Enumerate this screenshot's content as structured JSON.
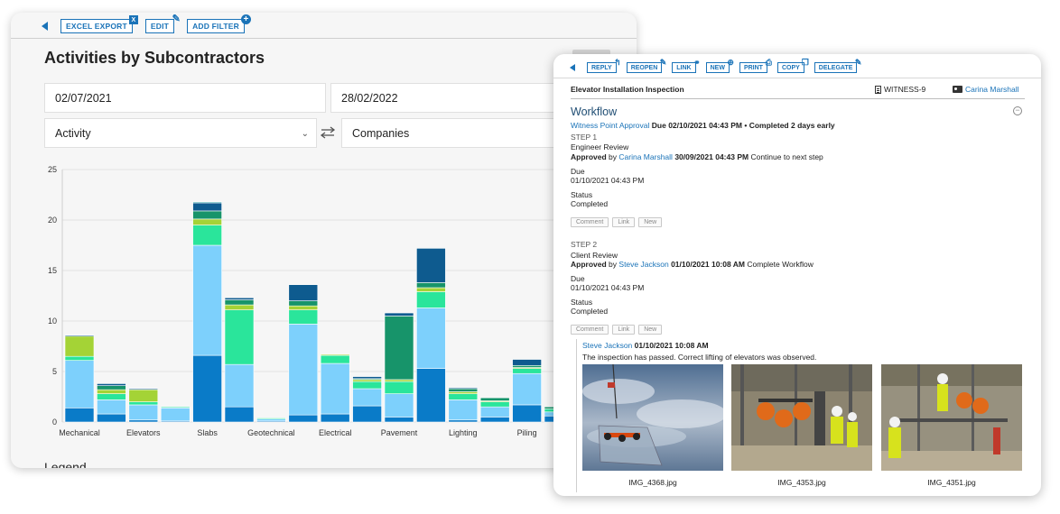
{
  "left": {
    "toolbar": {
      "excel_label": "EXCEL EXPORT",
      "excel_badge": "X",
      "edit_label": "EDIT",
      "filter_label": "ADD FILTER",
      "filter_badge": "+"
    },
    "title": "Activities by Subcontractors",
    "filters": {
      "start_date": "02/07/2021",
      "end_date": "28/02/2022",
      "activity_select": "Activity",
      "companies_select": "Companies"
    },
    "legend_heading": "Legend"
  },
  "chart_data": {
    "type": "bar",
    "stacked": true,
    "ylim": [
      0,
      25
    ],
    "yticks": [
      0,
      5,
      10,
      15,
      20,
      25
    ],
    "grid": true,
    "categories": [
      "Mechanical",
      "",
      "Elevators",
      "",
      "Slabs",
      "",
      "Geotechnical",
      "",
      "Electrical",
      "",
      "Pavement",
      "",
      "Lighting",
      "",
      "Piling",
      ""
    ],
    "series": [
      {
        "color": "#0a7bc8",
        "values": [
          1.4,
          0.8,
          0.2,
          0.1,
          6.6,
          1.5,
          0.1,
          0.7,
          0.8,
          1.6,
          0.5,
          5.3,
          0.2,
          0.5,
          1.7,
          0.6
        ]
      },
      {
        "color": "#7dd0fc",
        "values": [
          4.7,
          1.4,
          1.5,
          1.3,
          10.9,
          4.2,
          0.2,
          9.0,
          5.0,
          1.7,
          2.3,
          6.0,
          2.0,
          1.0,
          3.1,
          0.4
        ]
      },
      {
        "color": "#2ae59b",
        "values": [
          0.4,
          0.6,
          0.3,
          0.1,
          2.0,
          5.4,
          0.1,
          1.4,
          0.8,
          0.7,
          1.2,
          1.6,
          0.6,
          0.5,
          0.5,
          0.3
        ]
      },
      {
        "color": "#a4d336",
        "values": [
          2.0,
          0.4,
          1.2,
          0.0,
          0.6,
          0.5,
          0.0,
          0.4,
          0.1,
          0.2,
          0.2,
          0.4,
          0.2,
          0.1,
          0.1,
          0.0
        ]
      },
      {
        "color": "#17946a",
        "values": [
          0.0,
          0.4,
          0.0,
          0.0,
          0.8,
          0.5,
          0.0,
          0.5,
          0.0,
          0.1,
          6.3,
          0.5,
          0.3,
          0.3,
          0.2,
          0.2
        ]
      },
      {
        "color": "#0e5b8f",
        "values": [
          0.1,
          0.2,
          0.1,
          0.0,
          0.8,
          0.2,
          0.0,
          1.6,
          0.0,
          0.2,
          0.3,
          3.4,
          0.1,
          0.0,
          0.6,
          0.0
        ]
      },
      {
        "color": "#2b9fa5",
        "values": [
          0.0,
          0.0,
          0.0,
          0.0,
          0.1,
          0.0,
          0.0,
          0.0,
          0.0,
          0.0,
          0.0,
          0.0,
          0.0,
          0.0,
          0.0,
          0.0
        ]
      }
    ]
  },
  "right": {
    "toolbar": {
      "reply": "REPLY",
      "reopen": "REOPEN",
      "link": "LINK",
      "new": "NEW",
      "print": "PRINT",
      "copy": "COPY",
      "delegate": "DELEGATE"
    },
    "header": {
      "title": "Elevator Installation Inspection",
      "witness": "WITNESS-9",
      "user": "Carina Marshall"
    },
    "workflow": {
      "title": "Workflow",
      "collapse_glyph": "−",
      "summary_link": "Witness Point Approval",
      "summary_due": "Due 02/10/2021 04:43 PM",
      "summary_dot": "•",
      "summary_status": "Completed 2 days early",
      "steps": [
        {
          "label": "STEP 1",
          "name": "Engineer Review",
          "approved_prefix": "Approved",
          "by": "by",
          "approver": "Carina Marshall",
          "approved_at": "30/09/2021 04:43 PM",
          "approved_note": "Continue to next step",
          "due_label": "Due",
          "due_value": "01/10/2021 04:43 PM",
          "status_label": "Status",
          "status_value": "Completed",
          "actions": [
            "Comment",
            "Link",
            "New"
          ]
        },
        {
          "label": "STEP 2",
          "name": "Client Review",
          "approved_prefix": "Approved",
          "by": "by",
          "approver": "Steve Jackson",
          "approved_at": "01/10/2021 10:08 AM",
          "approved_note": "Complete Workflow",
          "due_label": "Due",
          "due_value": "01/10/2021 04:43 PM",
          "status_label": "Status",
          "status_value": "Completed",
          "actions": [
            "Comment",
            "Link",
            "New"
          ]
        }
      ],
      "comment": {
        "author": "Steve Jackson",
        "time": "01/10/2021 10:08 AM",
        "text": "The inspection has passed. Correct lifting of elevators was observed."
      },
      "attachments": [
        "IMG_4368.jpg",
        "IMG_4353.jpg",
        "IMG_4351.jpg"
      ]
    }
  }
}
